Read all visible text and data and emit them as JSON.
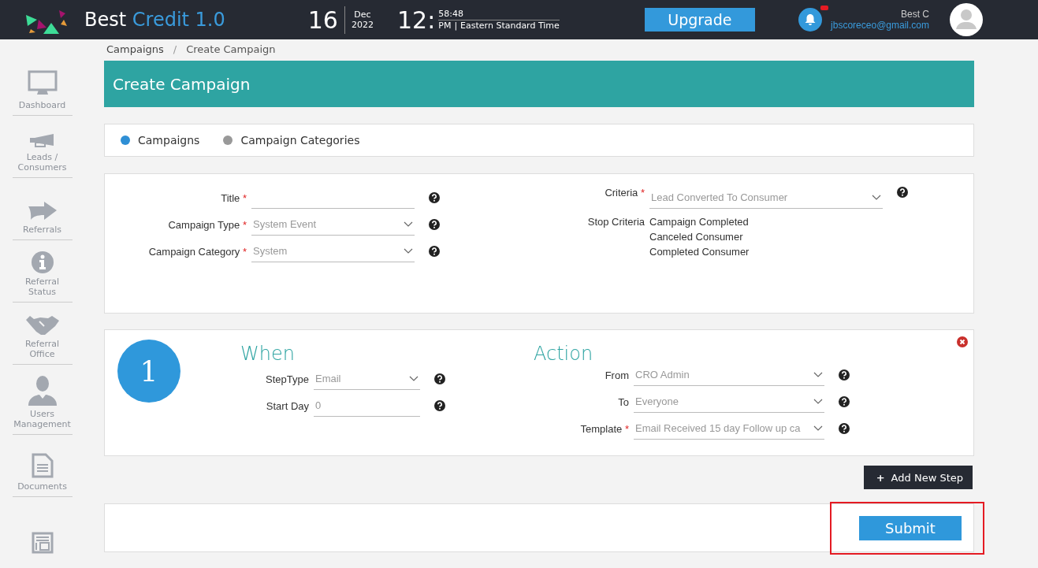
{
  "header": {
    "brand": {
      "prefix": "Best",
      "accent": "Credit 1.0"
    },
    "date": {
      "day": "16",
      "month": "Dec",
      "year": "2022"
    },
    "time": {
      "hour": "12:",
      "seconds": "58:48",
      "ampm": "PM",
      "divider": "|",
      "zone": "Eastern Standard Time"
    },
    "upgrade_button": "Upgrade",
    "user": {
      "name": "Best C",
      "email": "jbscoreceo@gmail.com"
    }
  },
  "sidebar": {
    "items": [
      {
        "kind": "monitor",
        "label": "Dashboard"
      },
      {
        "kind": "megaphone",
        "label": "Leads / Consumers"
      },
      {
        "kind": "arrow",
        "label": "Referrals"
      },
      {
        "kind": "info",
        "label": "Referral Status"
      },
      {
        "kind": "handshake",
        "label": "Referral Office"
      },
      {
        "kind": "user",
        "label": "Users Management"
      },
      {
        "kind": "document",
        "label": "Documents"
      },
      {
        "kind": "layout"
      }
    ]
  },
  "breadcrumb": {
    "items": [
      "Campaigns",
      "Create Campaign"
    ],
    "separator": "/"
  },
  "page_title": "Create Campaign",
  "tabs": [
    {
      "label": "Campaigns",
      "selected": true
    },
    {
      "label": "Campaign Categories",
      "selected": false
    }
  ],
  "form": {
    "left_fields": [
      {
        "label": "Title",
        "marker": "*",
        "kind": "text"
      },
      {
        "label": "Campaign Type",
        "marker": "*",
        "kind": "select",
        "value": "System Event"
      },
      {
        "label": "Campaign Category",
        "marker": "*",
        "kind": "select",
        "value": "System"
      }
    ],
    "criteria": {
      "label": "Criteria",
      "marker": "*",
      "kind": "select",
      "value": "Lead Converted To Consumer"
    },
    "stop_criteria": {
      "label": "Stop Criteria",
      "items": [
        "Campaign Completed",
        "Canceled Consumer",
        "Completed Consumer"
      ]
    }
  },
  "step": {
    "number": "1",
    "when_title": "When",
    "action_title": "Action",
    "when_fields": [
      {
        "label": "StepType",
        "kind": "select",
        "value": "Email"
      },
      {
        "label": "Start Day",
        "kind": "text",
        "value": "0"
      }
    ],
    "action_fields": [
      {
        "label": "From",
        "kind": "select",
        "value": "CRO Admin"
      },
      {
        "label": "To",
        "kind": "select",
        "value": "Everyone"
      },
      {
        "label": "Template",
        "marker": "*",
        "kind": "select",
        "value": "Email Received 15 day Follow up ca"
      }
    ]
  },
  "add_step_button": {
    "icon": "+",
    "label": "Add New Step"
  },
  "submit_button": {
    "label": "Submit",
    "highlighted": true
  }
}
